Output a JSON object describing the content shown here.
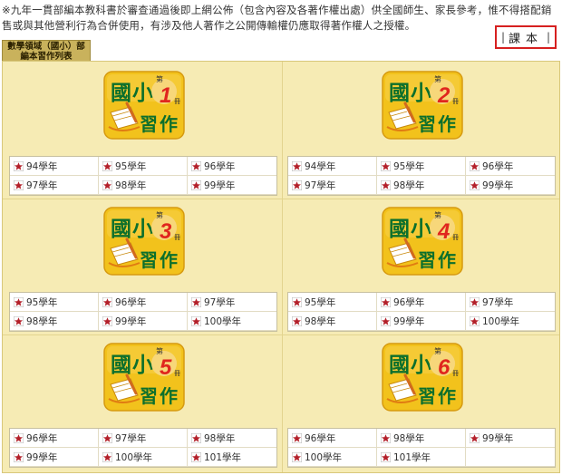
{
  "notice": "※九年一貫部編本教科書於審查通過後即上網公佈（包含內容及各著作權出處）供全國師生、家長參考，惟不得搭配銷售或與其他營利行為合併使用，有涉及他人著作之公開傳輸權仍應取得著作權人之授權。",
  "tab": {
    "bar_left": "|",
    "label": "課本",
    "bar_right": "|"
  },
  "section_tab": {
    "line1": "數學領域（國小）部",
    "line2": "編本習作列表"
  },
  "book_text": {
    "guo": "國",
    "xiao": "小",
    "di": "第",
    "ce": "冊",
    "xi": "習",
    "zuo": "作"
  },
  "colors": {
    "grid_bg": "#f6ebb4",
    "book_gold": "#f2c21c",
    "book_green": "#0c6f2c",
    "number_red": "#e0261e",
    "star_red": "#b3202a"
  },
  "books": [
    {
      "number": "1",
      "years": [
        "94學年",
        "95學年",
        "96學年",
        "97學年",
        "98學年",
        "99學年"
      ]
    },
    {
      "number": "2",
      "years": [
        "94學年",
        "95學年",
        "96學年",
        "97學年",
        "98學年",
        "99學年"
      ]
    },
    {
      "number": "3",
      "years": [
        "95學年",
        "96學年",
        "97學年",
        "98學年",
        "99學年",
        "100學年"
      ]
    },
    {
      "number": "4",
      "years": [
        "95學年",
        "96學年",
        "97學年",
        "98學年",
        "99學年",
        "100學年"
      ]
    },
    {
      "number": "5",
      "years": [
        "96學年",
        "97學年",
        "98學年",
        "99學年",
        "100學年",
        "101學年"
      ]
    },
    {
      "number": "6",
      "years": [
        "96學年",
        "98學年",
        "99學年",
        "100學年",
        "101學年"
      ]
    }
  ]
}
